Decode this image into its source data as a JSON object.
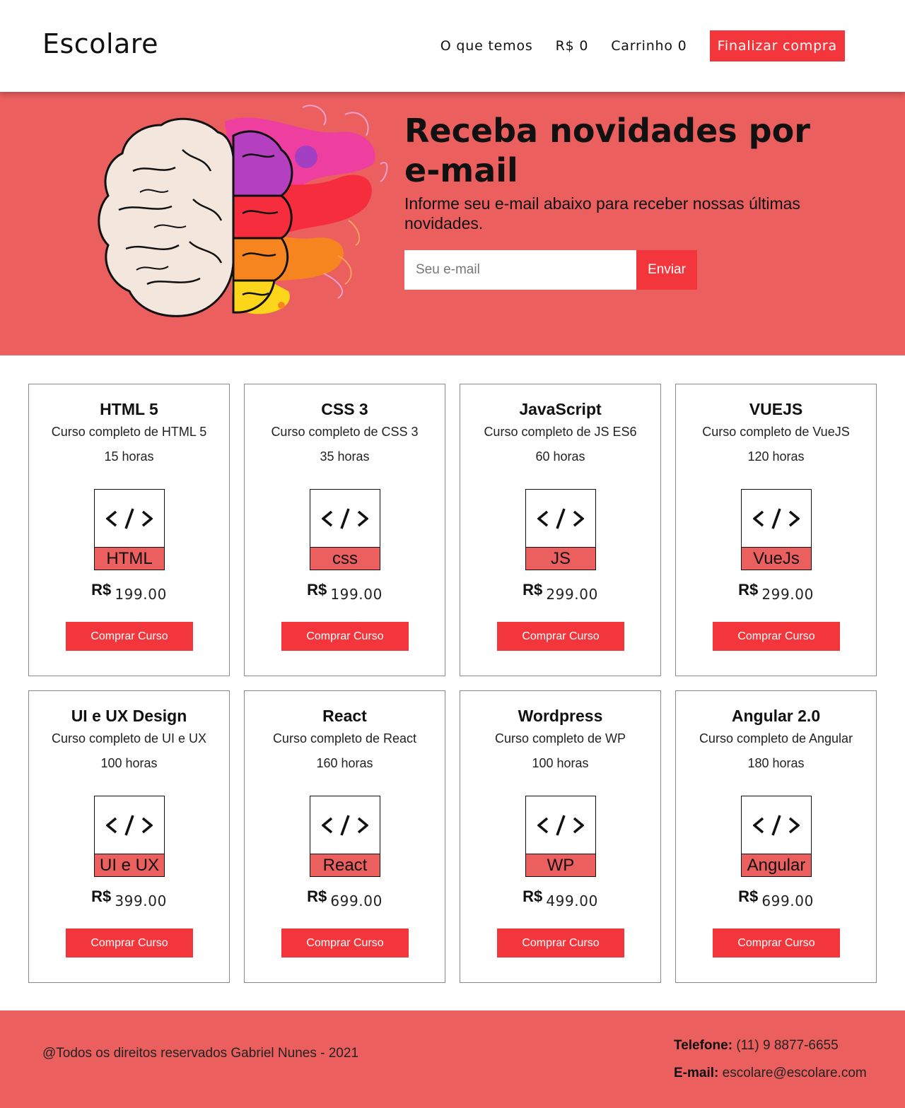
{
  "header": {
    "logo": "Escolare",
    "nav": {
      "what_we_have": "O que temos",
      "balance": "R$ 0",
      "cart": "Carrinho 0",
      "checkout": "Finalizar compra"
    }
  },
  "hero": {
    "title": "Receba novidades por e-mail",
    "subtitle": "Informe seu e-mail abaixo para receber nossas últimas novidades.",
    "email_placeholder": "Seu e-mail",
    "send_label": "Enviar",
    "image_icon": "brain-illustration"
  },
  "courses": [
    {
      "title": "HTML 5",
      "desc": "Curso completo de HTML 5",
      "hours": "15 horas",
      "tag": "HTML",
      "currency": "R$",
      "price": "199.00",
      "buy": "Comprar Curso"
    },
    {
      "title": "CSS 3",
      "desc": "Curso completo de CSS 3",
      "hours": "35 horas",
      "tag": "css",
      "currency": "R$",
      "price": "199.00",
      "buy": "Comprar Curso"
    },
    {
      "title": "JavaScript",
      "desc": "Curso completo de JS ES6",
      "hours": "60 horas",
      "tag": "JS",
      "currency": "R$",
      "price": "299.00",
      "buy": "Comprar Curso"
    },
    {
      "title": "VUEJS",
      "desc": "Curso completo de VueJS",
      "hours": "120 horas",
      "tag": "VueJs",
      "currency": "R$",
      "price": "299.00",
      "buy": "Comprar Curso"
    },
    {
      "title": "UI e UX Design",
      "desc": "Curso completo de UI e UX",
      "hours": "100 horas",
      "tag": "UI e UX",
      "currency": "R$",
      "price": "399.00",
      "buy": "Comprar Curso"
    },
    {
      "title": "React",
      "desc": "Curso completo de React",
      "hours": "160 horas",
      "tag": "React",
      "currency": "R$",
      "price": "699.00",
      "buy": "Comprar Curso"
    },
    {
      "title": "Wordpress",
      "desc": "Curso completo de WP",
      "hours": "100 horas",
      "tag": "WP",
      "currency": "R$",
      "price": "499.00",
      "buy": "Comprar Curso"
    },
    {
      "title": "Angular 2.0",
      "desc": "Curso completo de Angular",
      "hours": "180 horas",
      "tag": "Angular",
      "currency": "R$",
      "price": "699.00",
      "buy": "Comprar Curso"
    }
  ],
  "footer": {
    "copyright": "@Todos os direitos reservados Gabriel Nunes - 2021",
    "phone_label": "Telefone:",
    "phone_value": "(11) 9 8877-6655",
    "email_label": "E-mail:",
    "email_value": "escolare@escolare.com"
  },
  "colors": {
    "accent": "#f2363c",
    "hero_bg": "#ec5f5f"
  }
}
